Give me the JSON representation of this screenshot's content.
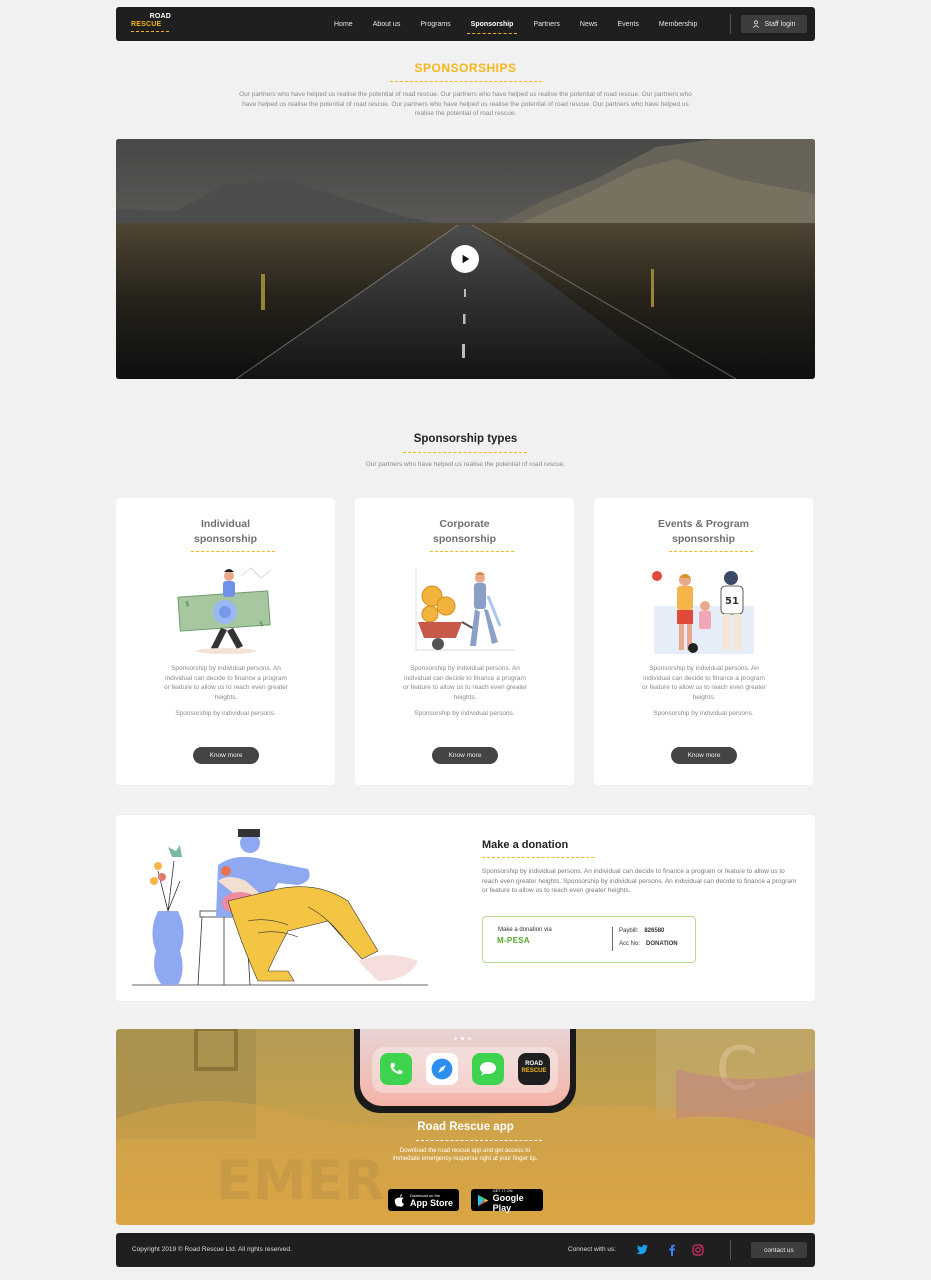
{
  "nav": {
    "logo_line1": "ROAD",
    "logo_line2": "RESCUE",
    "links": [
      "Home",
      "About us",
      "Programs",
      "Sponsorship",
      "Partners",
      "News",
      "Events",
      "Membership"
    ],
    "active": "Sponsorship",
    "staff_login": "Staff login"
  },
  "page": {
    "title": "SPONSORSHIPS",
    "intro": "Our partners who have helped us realise the potential of road rescue. Our partners who have helped us realise the potential of road rescue. Our partners who have helped us realise the potential of road rescue. Our partners who have helped us realise the potential of road rescue. Our partners who have helped us realise the potential of road rescue."
  },
  "types": {
    "title": "Sponsorship types",
    "subtitle": "Our partners who have helped us realise the potential of road rescue.",
    "cards": [
      {
        "title": "Individual sponsorship",
        "desc": "Sponsorship by individual persons. An individual can decide to finance a program or feature to allow us to reach even greater heights.",
        "desc2": "Sponsorship by individual persons.",
        "button": "Know more"
      },
      {
        "title": "Corporate sponsorship",
        "desc": "Sponsorship by individual persons. An individual can decide to finance a program or feature to allow us to reach even greater heights.",
        "desc2": "Sponsorship by individual persons.",
        "button": "Know more"
      },
      {
        "title": "Events & Program sponsorship",
        "desc": "Sponsorship by individual persons. An individual can decide to finance a program or feature to allow us to reach even greater heights.",
        "desc2": "Sponsorship by individual persons.",
        "button": "Know more"
      }
    ]
  },
  "donation": {
    "title": "Make a donation",
    "text": "Sponsorship by individual persons. An individual can decide to finance a program or feature to allow us to reach even greater heights. Sponsorship by individual persons. An individual can decide to finance a program or feature to allow us to reach even greater heights.",
    "via_label": "Make a donation via",
    "mpesa_logo": "M-PESA",
    "paybill_label": "Paybill:",
    "paybill_value": "826580",
    "accno_label": "Acc No:",
    "accno_value": "DONATION"
  },
  "app": {
    "title": "Road Rescue app",
    "desc": "Download the road rescue app and get access to immediate emergency response right at your finger tip.",
    "appstore_small": "Download on the",
    "appstore_big": "App Store",
    "gplay_small": "GET IT ON",
    "gplay_big": "Google Play",
    "phone_logo_line1": "ROAD",
    "phone_logo_line2": "RESCUE"
  },
  "footer": {
    "copyright": "Copyright 2019 © Road Rescue Ltd.  All rights reserved.",
    "connect": "Connect with us:",
    "contact": "contact us"
  },
  "colors": {
    "accent": "#f6b51a",
    "dark": "#1f1f1f",
    "mpesa_green": "#55a630"
  }
}
